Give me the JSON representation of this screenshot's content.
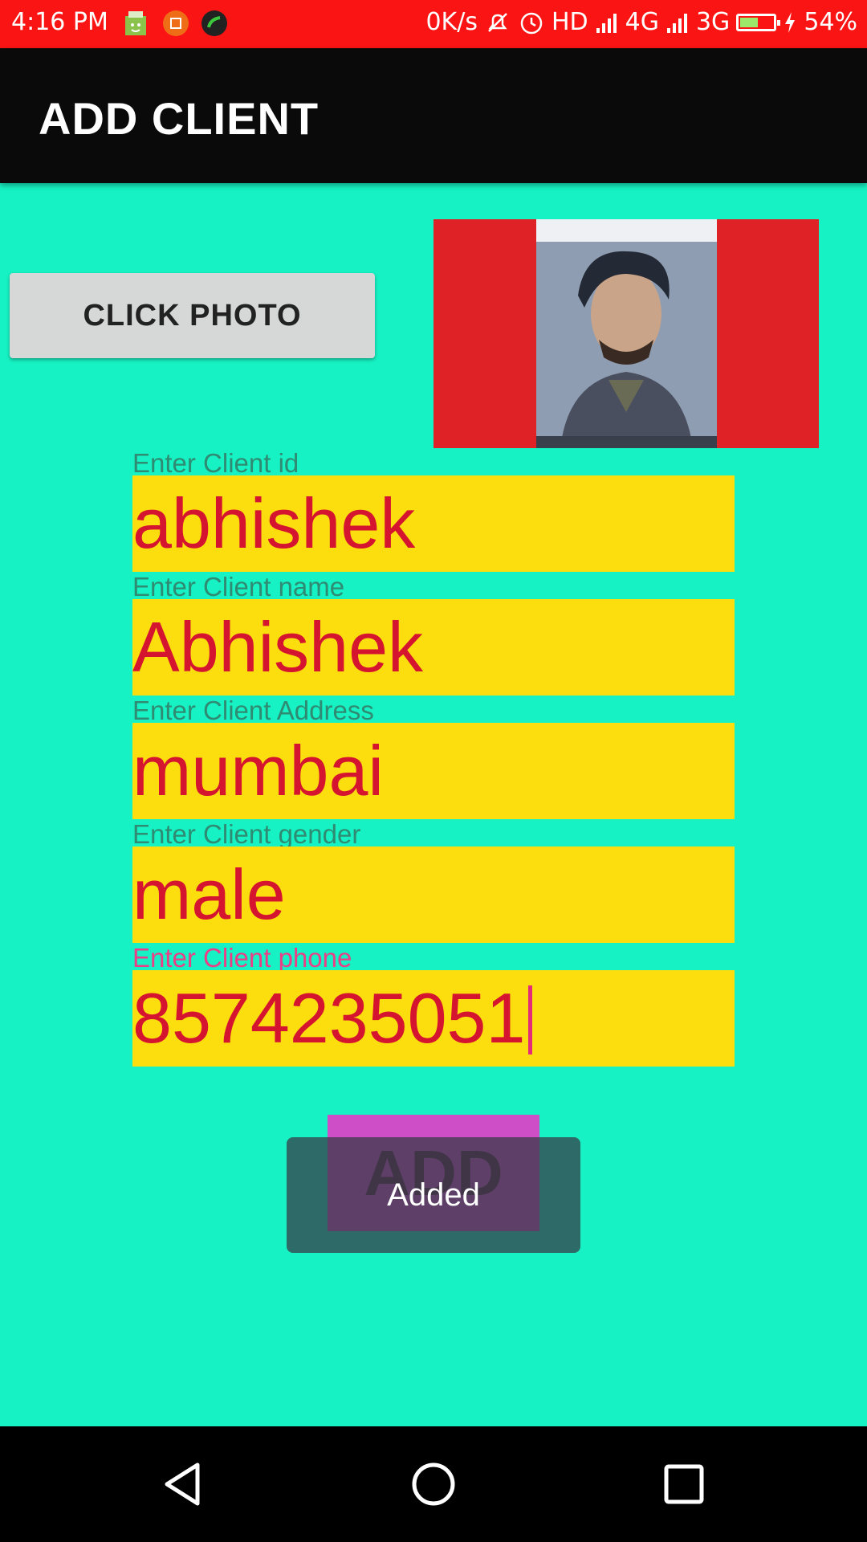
{
  "status_bar": {
    "time": "4:16 PM",
    "net_speed": "0K/s",
    "hd": "HD",
    "network_4g": "4G",
    "network_3g": "3G",
    "battery_percent": "54%",
    "battery_level": 0.54,
    "notification_icons": [
      "store-icon",
      "crop-icon",
      "phone-icon"
    ]
  },
  "app_bar": {
    "title": "ADD CLIENT"
  },
  "photo": {
    "button_label": "CLICK PHOTO"
  },
  "form": {
    "fields": [
      {
        "label": "Enter Client id",
        "value": "abhishek"
      },
      {
        "label": "Enter Client name",
        "value": "Abhishek"
      },
      {
        "label": "Enter Client Address",
        "value": "mumbai"
      },
      {
        "label": "Enter Client gender",
        "value": "male"
      },
      {
        "label": "Enter Client phone",
        "value": "8574235051"
      }
    ],
    "add_label": "ADD"
  },
  "toast": {
    "message": "Added"
  },
  "nav": {
    "buttons": [
      "back-icon",
      "home-icon",
      "recents-icon"
    ]
  },
  "colors": {
    "background": "#16f2c3",
    "status_bar": "#fb1414",
    "field_bg": "#fcdd0d",
    "field_text": "#d5142f",
    "photo_frame": "#df2226",
    "add_button": "#ce4ec8"
  }
}
